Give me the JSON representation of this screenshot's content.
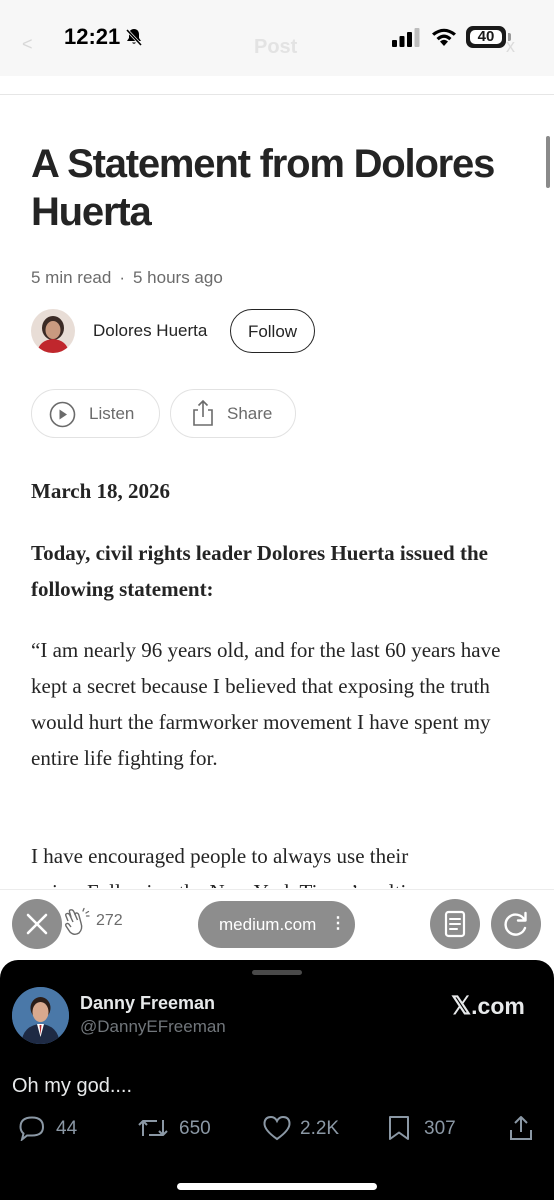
{
  "status_bar": {
    "time": "12:21",
    "battery": "40",
    "faded_back": "<",
    "faded_title": "Post",
    "faded_close": "x"
  },
  "article": {
    "title": "A Statement from Dolores Huerta",
    "read_time": "5 min read",
    "separator": "·",
    "posted": "5 hours ago",
    "author": "Dolores Huerta",
    "follow_label": "Follow",
    "listen_label": "Listen",
    "share_label": "Share",
    "date_line": "March 18, 2026",
    "lead": "Today, civil rights leader Dolores Huerta issued the following statement:",
    "quote": "“I am nearly 96 years old, and for the last 60 years have kept a secret because I believed that exposing the truth would hurt the farmworker movement I have spent my entire life fighting for.",
    "para3": "I have encouraged people to always use their",
    "para_cut": "voice. Following the New York Times’ multi-"
  },
  "browser_bar": {
    "clap_count": "272",
    "url": "medium.com",
    "url_more": "⋮"
  },
  "tweet": {
    "name": "Danny Freeman",
    "handle": "@DannyEFreeman",
    "site_mark": "𝕏",
    "site_suffix": ".com",
    "text": "Oh my god....",
    "replies": "44",
    "retweets": "650",
    "likes": "2.2K",
    "bookmarks": "307"
  },
  "colors": {
    "text": "#242424",
    "muted": "#6b6b6b",
    "tweet_bg": "#000000",
    "tweet_muted": "#8b98a5",
    "button_gray": "#8d8d8d"
  }
}
